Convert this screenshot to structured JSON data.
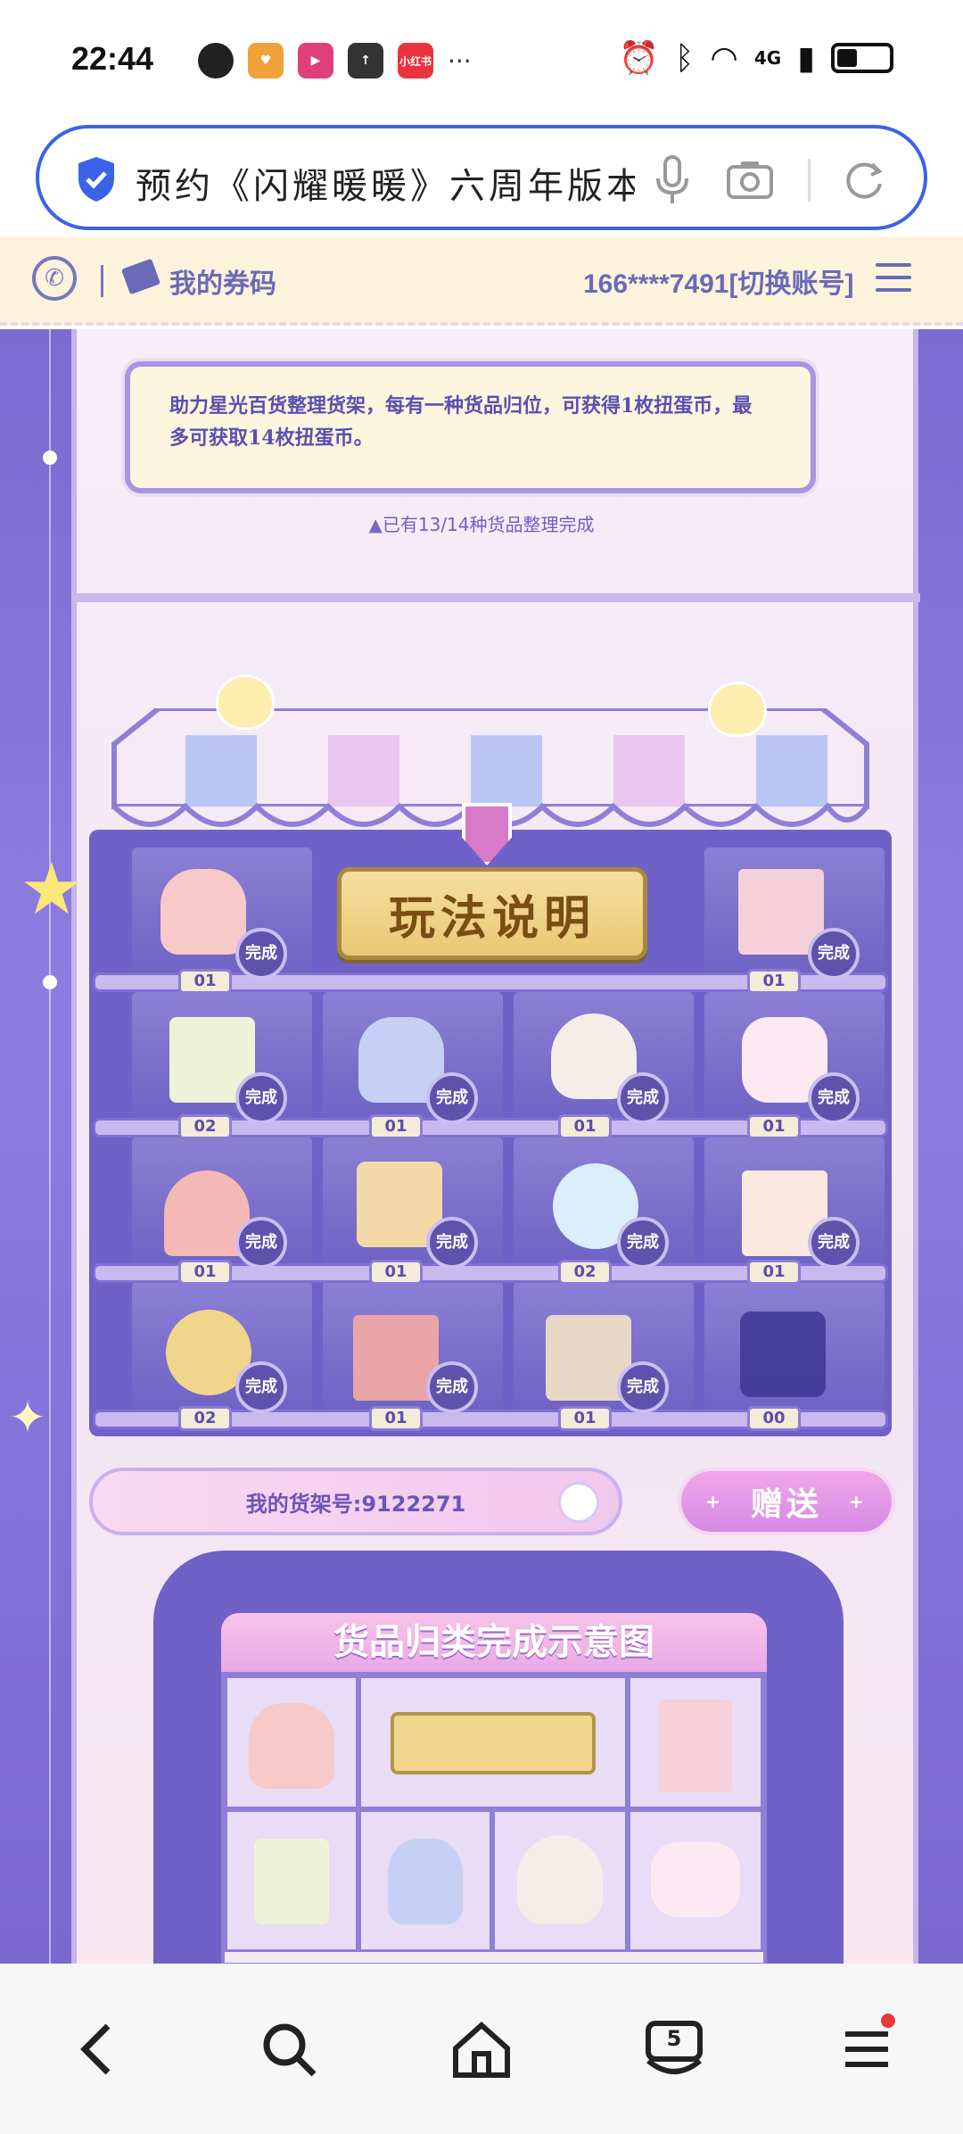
{
  "status_bar": {
    "time": "22:44",
    "apps": [
      {
        "icon": "penguin-icon",
        "label": "",
        "color": "#222222"
      },
      {
        "icon": "heart-app-icon",
        "label": "",
        "color": "#f0a13a"
      },
      {
        "icon": "play-app-icon",
        "label": "",
        "color": "#e0407a"
      },
      {
        "icon": "upload-app-icon",
        "label": "",
        "color": "#333333"
      },
      {
        "icon": "xiaohongshu-icon",
        "label": "小红书",
        "color": "#e8343f"
      }
    ],
    "more": "···",
    "network": "4G"
  },
  "address_bar": {
    "text": "预约《闪耀暖暖》六周年版本"
  },
  "top_strip": {
    "coupon_label": "我的券码",
    "account": "166****7491[切换账号]"
  },
  "notice": {
    "text": "助力星光百货整理货架，每有一种货品归位，可获得1枚扭蛋币，最多可获取14枚扭蛋币。",
    "progress": "已有13/14种货品整理完成"
  },
  "shelf": {
    "help_label": "玩法说明",
    "done_label": "完成",
    "rows": [
      [
        {
          "item": "bunny-backpack",
          "count": "01",
          "done": true
        },
        {
          "item": "help",
          "count": "",
          "done": false
        },
        {
          "item": "photo-album",
          "count": "01",
          "done": true
        }
      ],
      [
        {
          "item": "flower-basket",
          "count": "02",
          "done": true
        },
        {
          "item": "perfume-bottle",
          "count": "01",
          "done": true
        },
        {
          "item": "shell-ring",
          "count": "01",
          "done": true
        },
        {
          "item": "bunny-mug",
          "count": "01",
          "done": true
        }
      ],
      [
        {
          "item": "pink-cap",
          "count": "01",
          "done": true
        },
        {
          "item": "suitcase",
          "count": "01",
          "done": true
        },
        {
          "item": "crystal-ball",
          "count": "02",
          "done": true
        },
        {
          "item": "milk-carton",
          "count": "01",
          "done": true
        }
      ],
      [
        {
          "item": "moon-pillow",
          "count": "02",
          "done": true
        },
        {
          "item": "eyeshadow-palette",
          "count": "01",
          "done": true
        },
        {
          "item": "layer-cake",
          "count": "01",
          "done": true
        },
        {
          "item": "camera",
          "count": "00",
          "done": false
        }
      ]
    ],
    "shelf_number": "我的货架号:9122271",
    "gift_button": "赠送"
  },
  "diagram": {
    "title": "货品归类完成示意图"
  },
  "colors": {
    "accent": "#3a63e8",
    "purple": "#6f61c7",
    "done_badge": "#5e52ad"
  },
  "bottom_nav": {
    "tabs_count": "5"
  }
}
